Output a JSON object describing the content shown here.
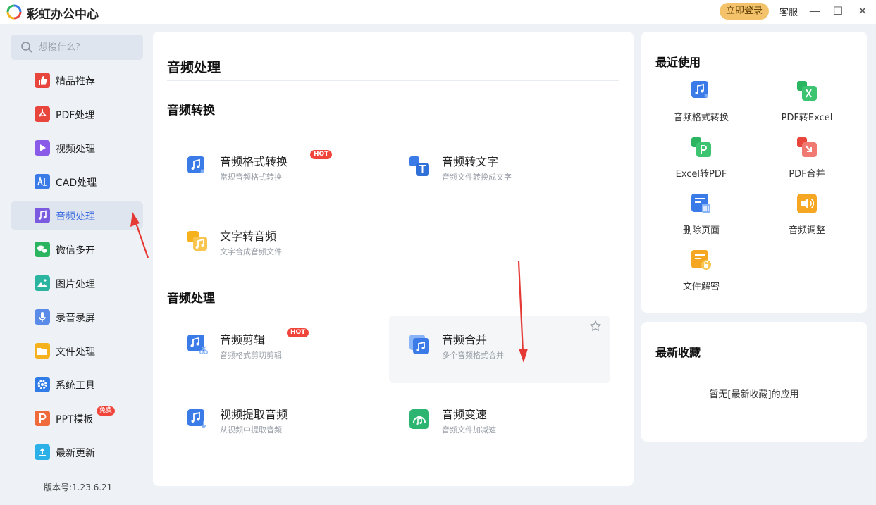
{
  "app": {
    "title": "彩虹办公中心",
    "login_label": "立即登录",
    "service_label": "客服"
  },
  "window_controls": {
    "minimize": "—",
    "maximize": "☐",
    "close": "✕"
  },
  "search": {
    "placeholder": "想搜什么?"
  },
  "sidebar": {
    "items": [
      {
        "label": "精品推荐",
        "icon": "thumbs-up-icon",
        "color": "#e8453c"
      },
      {
        "label": "PDF处理",
        "icon": "pdf-icon",
        "color": "#e8453c"
      },
      {
        "label": "视频处理",
        "icon": "video-play-icon",
        "color": "#8a5be8"
      },
      {
        "label": "CAD处理",
        "icon": "cad-icon",
        "color": "#3a7be8"
      },
      {
        "label": "音频处理",
        "icon": "music-note-icon",
        "color": "#7a5be0",
        "active": true
      },
      {
        "label": "微信多开",
        "icon": "wechat-icon",
        "color": "#2cb560"
      },
      {
        "label": "图片处理",
        "icon": "image-icon",
        "color": "#2bb5a0"
      },
      {
        "label": "录音录屏",
        "icon": "microphone-icon",
        "color": "#5b8be8"
      },
      {
        "label": "文件处理",
        "icon": "folder-icon",
        "color": "#f5b21c"
      },
      {
        "label": "系统工具",
        "icon": "gear-icon",
        "color": "#2f7be8"
      },
      {
        "label": "PPT模板",
        "icon": "ppt-icon",
        "color": "#f06a3c",
        "badge": "免费"
      },
      {
        "label": "最新更新",
        "icon": "upload-arrow-icon",
        "color": "#2bb0e8"
      }
    ],
    "version": "版本号:1.23.6.21"
  },
  "main": {
    "title": "音频处理",
    "sections": [
      {
        "title": "音频转换",
        "tools": [
          {
            "title": "音频格式转换",
            "desc": "常规音频格式转换",
            "badge": "HOT",
            "icon": "audio-convert-icon"
          },
          {
            "title": "音频转文字",
            "desc": "音频文件转换成文字",
            "icon": "audio-to-text-icon"
          },
          {
            "title": "文字转音频",
            "desc": "文字合成音频文件",
            "icon": "text-to-audio-icon"
          }
        ]
      },
      {
        "title": "音频处理",
        "tools": [
          {
            "title": "音频剪辑",
            "desc": "音频格式剪切剪辑",
            "badge": "HOT",
            "icon": "audio-cut-icon"
          },
          {
            "title": "音频合并",
            "desc": "多个音频格式合并",
            "icon": "audio-merge-icon"
          },
          {
            "title": "视频提取音频",
            "desc": "从视频中提取音频",
            "icon": "video-extract-audio-icon"
          },
          {
            "title": "音频变速",
            "desc": "音频文件加减速",
            "icon": "audio-speed-icon"
          }
        ]
      }
    ]
  },
  "recent": {
    "title": "最近使用",
    "items": [
      {
        "label": "音频格式转换",
        "icon": "audio-convert-icon"
      },
      {
        "label": "PDF转Excel",
        "icon": "pdf-to-excel-icon"
      },
      {
        "label": "Excel转PDF",
        "icon": "excel-to-pdf-icon"
      },
      {
        "label": "PDF合并",
        "icon": "pdf-merge-icon"
      },
      {
        "label": "删除页面",
        "icon": "delete-page-icon"
      },
      {
        "label": "音频调整",
        "icon": "audio-adjust-icon"
      },
      {
        "label": "文件解密",
        "icon": "file-decrypt-icon"
      }
    ]
  },
  "favorites": {
    "title": "最新收藏",
    "empty_text": "暂无[最新收藏]的应用"
  },
  "colors": {
    "accent": "#3f6fe0",
    "hot_badge": "#f0453a",
    "login": "#f3c26b",
    "annotation_arrow": "#e53935"
  }
}
